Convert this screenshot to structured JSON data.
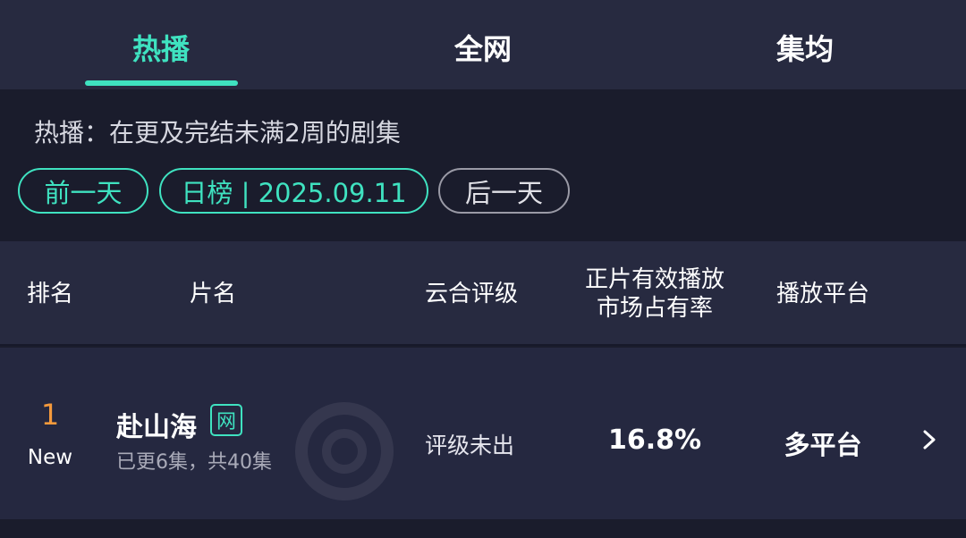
{
  "tabs": [
    {
      "label": "热播",
      "active": true
    },
    {
      "label": "全网",
      "active": false
    },
    {
      "label": "集均",
      "active": false
    }
  ],
  "description": "热播：在更及完结未满2周的剧集",
  "date_controls": {
    "prev_label": "前一天",
    "current_label": "日榜 | 2025.09.11",
    "next_label": "后一天"
  },
  "table": {
    "headers": {
      "rank": "排名",
      "title": "片名",
      "rating": "云合评级",
      "share_line1": "正片有效播放",
      "share_line2": "市场占有率",
      "platform": "播放平台"
    },
    "rows": [
      {
        "rank": "1",
        "badge": "New",
        "title": "赴山海",
        "tag": "网",
        "episodes": "已更6集，共40集",
        "rating": "评级未出",
        "share": "16.8%",
        "platform": "多平台"
      }
    ]
  },
  "icons": {
    "row_arrow": "chevron-right-icon"
  },
  "colors": {
    "accent": "#3fe2c0",
    "rank_orange": "#f59a3c",
    "background": "#1a1c2c",
    "panel": "#272a40"
  }
}
